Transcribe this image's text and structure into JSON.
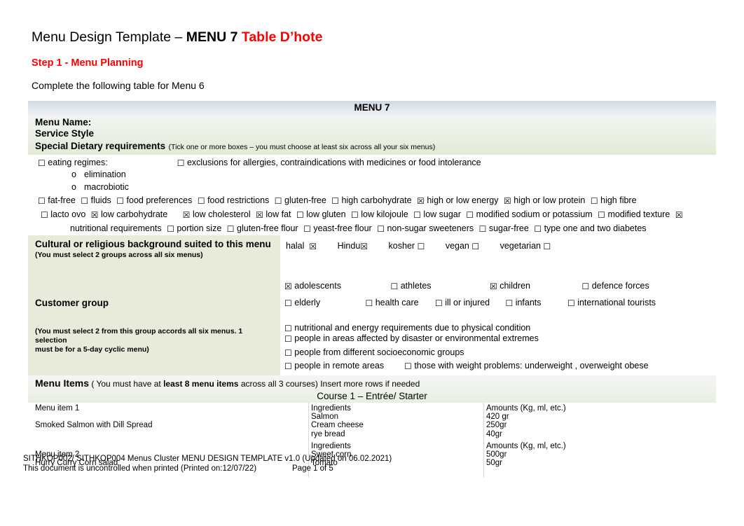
{
  "header": {
    "title_plain": "Menu Design Template – ",
    "title_bold": "MENU 7 ",
    "title_red": "Table D’hote",
    "step": "Step 1 - Menu Planning",
    "instruction": "Complete the following table for Menu 6"
  },
  "table": {
    "banner": "MENU 7",
    "menu_name_label": "Menu Name:",
    "service_style_label": "Service Style",
    "special_dietary": {
      "label": "Special Dietary requirements",
      "note": "(Tick one or more boxes – you must choose at least six across all your six menus)",
      "regimes_label": "eating regimes:",
      "regimes_checked": false,
      "exclusions_label": "exclusions for allergies, contraindications with medicines or food intolerance",
      "exclusions_checked": false,
      "sub_items": [
        "elimination",
        "macrobiotic"
      ],
      "line1": [
        {
          "label": "fat-free",
          "checked": false
        },
        {
          "label": "fluids",
          "checked": false
        },
        {
          "label": "food preferences",
          "checked": false
        },
        {
          "label": "food restrictions",
          "checked": false
        },
        {
          "label": "gluten-free",
          "checked": false
        },
        {
          "label": "high carbohydrate",
          "checked": false
        },
        {
          "label": "high or low energy",
          "checked": true
        },
        {
          "label": "high or low protein",
          "checked": true
        },
        {
          "label": "high fibre",
          "checked": false
        }
      ],
      "line2": [
        {
          "label": "lacto ovo",
          "checked": false
        },
        {
          "label": "low carbohydrate",
          "checked": true
        },
        {
          "label": "low cholesterol",
          "checked": true
        },
        {
          "label": "low fat",
          "checked": true
        },
        {
          "label": "low gluten",
          "checked": false
        },
        {
          "label": "low kilojoule",
          "checked": false
        },
        {
          "label": "low sugar",
          "checked": false
        },
        {
          "label": "modified sodium or potassium",
          "checked": false
        },
        {
          "label": "modified texture",
          "checked": false
        }
      ],
      "line3": [
        {
          "label": "nutritional requirements",
          "checked": true
        },
        {
          "label": "portion size",
          "checked": false
        },
        {
          "label": "gluten-free flour",
          "checked": false
        },
        {
          "label": "yeast-free flour",
          "checked": false
        },
        {
          "label": "non-sugar sweeteners",
          "checked": false
        },
        {
          "label": "sugar-free",
          "checked": false
        },
        {
          "label": "type one and two diabetes",
          "checked": false
        }
      ]
    },
    "cultural": {
      "heading": "Cultural or religious background suited to this menu",
      "note": "(You must select 2 groups across all six menus)",
      "options": [
        {
          "label": "halal",
          "checked": true
        },
        {
          "label": "Hindu",
          "checked": true
        },
        {
          "label": "kosher",
          "checked": false
        },
        {
          "label": "vegan",
          "checked": false
        },
        {
          "label": "vegetarian",
          "checked": false
        }
      ]
    },
    "customer_group": {
      "heading": "Customer group",
      "note_line1": "(You must select 2 from  this group accords all six menus. 1 selection",
      "note_line2": "must be for a 5-day cyclic menu)",
      "row1": [
        {
          "label": "adolescents",
          "checked": true
        },
        {
          "label": "athletes",
          "checked": false
        },
        {
          "label": "children",
          "checked": true
        },
        {
          "label": "defence forces",
          "checked": false
        }
      ],
      "row2": [
        {
          "label": "elderly",
          "checked": false
        },
        {
          "label": "health care",
          "checked": false
        },
        {
          "label": "ill or injured",
          "checked": false
        },
        {
          "label": "infants",
          "checked": false
        },
        {
          "label": "international  tourists",
          "checked": false
        }
      ],
      "row3": [
        {
          "label": "nutritional and energy requirements due to physical condition",
          "checked": false
        },
        {
          "label": "people in areas affected by disaster or environmental extremes",
          "checked": false
        },
        {
          "label": "people from different socioeconomic groups",
          "checked": false
        }
      ],
      "row4": [
        {
          "label": "people in remote areas",
          "checked": false
        },
        {
          "label": "those with weight problems: underweight , overweight obese",
          "checked": false
        }
      ]
    },
    "menu_items": {
      "title": "Menu Items",
      "note_a": " ( You must have at ",
      "note_b": "least 8 menu items",
      "note_c": " across all 3 courses) Insert more rows if needed",
      "course_title": "Course 1 – Entrée/ Starter",
      "items": [
        {
          "item_label": "Menu item 1",
          "item_name": "Smoked Salmon with Dill Spread",
          "ingredients_header": "Ingredients",
          "amounts_header": "Amounts (Kg, ml, etc.)",
          "rows": [
            {
              "ingredient": "Salmon",
              "amount": "420 gr"
            },
            {
              "ingredient": "Cream cheese",
              "amount": "250gr"
            },
            {
              "ingredient": "rye bread",
              "amount": "40gr"
            }
          ]
        },
        {
          "item_label": "Menu item 2",
          "item_name": "Hurry Curry Corn salad",
          "ingredients_header": "Ingredients",
          "amounts_header": "Amounts (Kg, ml, etc.)",
          "rows": [
            {
              "ingredient": "Sweet corn",
              "amount": "500gr"
            },
            {
              "ingredient": "Tomato",
              "amount": "50gr"
            }
          ]
        }
      ]
    }
  },
  "footer": {
    "line1": "SITHKOP002/ SITHKOP004 Menus Cluster MENU DESIGN TEMPLATE v1.0 (Updated on 06.02.2021)",
    "line2": "This document is uncontrolled when printed (Printed on:12/07/22)",
    "page": "Page 1 of 5"
  },
  "glyphs": {
    "checked": "☒",
    "unchecked": "☐",
    "bullet_o": "o"
  }
}
